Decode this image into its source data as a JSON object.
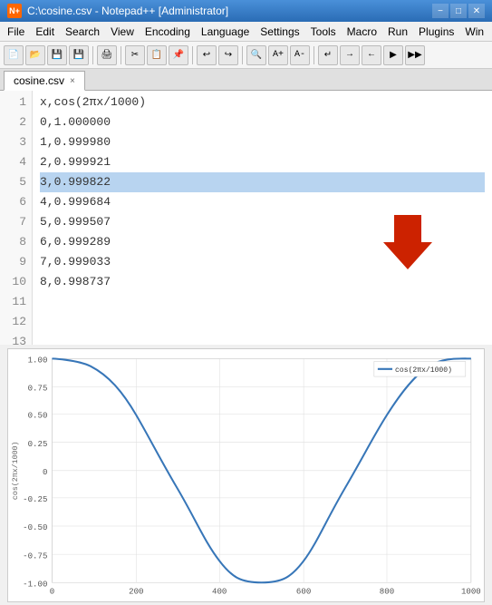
{
  "titleBar": {
    "title": "C:\\cosine.csv - Notepad++ [Administrator]",
    "icon": "N++",
    "buttons": [
      "−",
      "□",
      "✕"
    ]
  },
  "menuBar": {
    "items": [
      "File",
      "Edit",
      "Search",
      "View",
      "Encoding",
      "Language",
      "Settings",
      "Tools",
      "Macro",
      "Run",
      "Plugins",
      "Win"
    ]
  },
  "tab": {
    "label": "cosine.csv",
    "closeIcon": "×"
  },
  "lines": [
    {
      "num": "1",
      "code": "x,cos(2πx/1000)",
      "highlighted": false
    },
    {
      "num": "2",
      "code": "0,1.000000",
      "highlighted": false
    },
    {
      "num": "3",
      "code": "1,0.999980",
      "highlighted": false
    },
    {
      "num": "4",
      "code": "2,0.999921",
      "highlighted": false
    },
    {
      "num": "5",
      "code": "3,0.999822",
      "highlighted": true
    },
    {
      "num": "6",
      "code": "4,0.999684",
      "highlighted": false
    },
    {
      "num": "7",
      "code": "5,0.999507",
      "highlighted": false
    },
    {
      "num": "8",
      "code": "6,0.999289",
      "highlighted": false
    },
    {
      "num": "9",
      "code": "7,0.999033",
      "highlighted": false
    },
    {
      "num": "10",
      "code": "8,0.998737",
      "highlighted": false
    },
    {
      "num": "11",
      "code": "",
      "highlighted": false
    },
    {
      "num": "12",
      "code": "",
      "highlighted": false
    },
    {
      "num": "13",
      "code": "",
      "highlighted": false
    }
  ],
  "chart": {
    "legendLabel": "cos(2πx/1000)",
    "yLabel": "cos(2πx/1000)",
    "xTicks": [
      "0",
      "200",
      "400",
      "600",
      "800",
      "1000"
    ],
    "yTicks": [
      "1.00",
      "0.75",
      "0.50",
      "0.25",
      "0",
      "-0.25",
      "-0.50",
      "-0.75",
      "-1.00"
    ]
  },
  "colors": {
    "highlight": "#b8d4f0",
    "chartLine": "#3776b8",
    "chartGrid": "#e8e8e8",
    "arrowRed": "#cc0000"
  }
}
